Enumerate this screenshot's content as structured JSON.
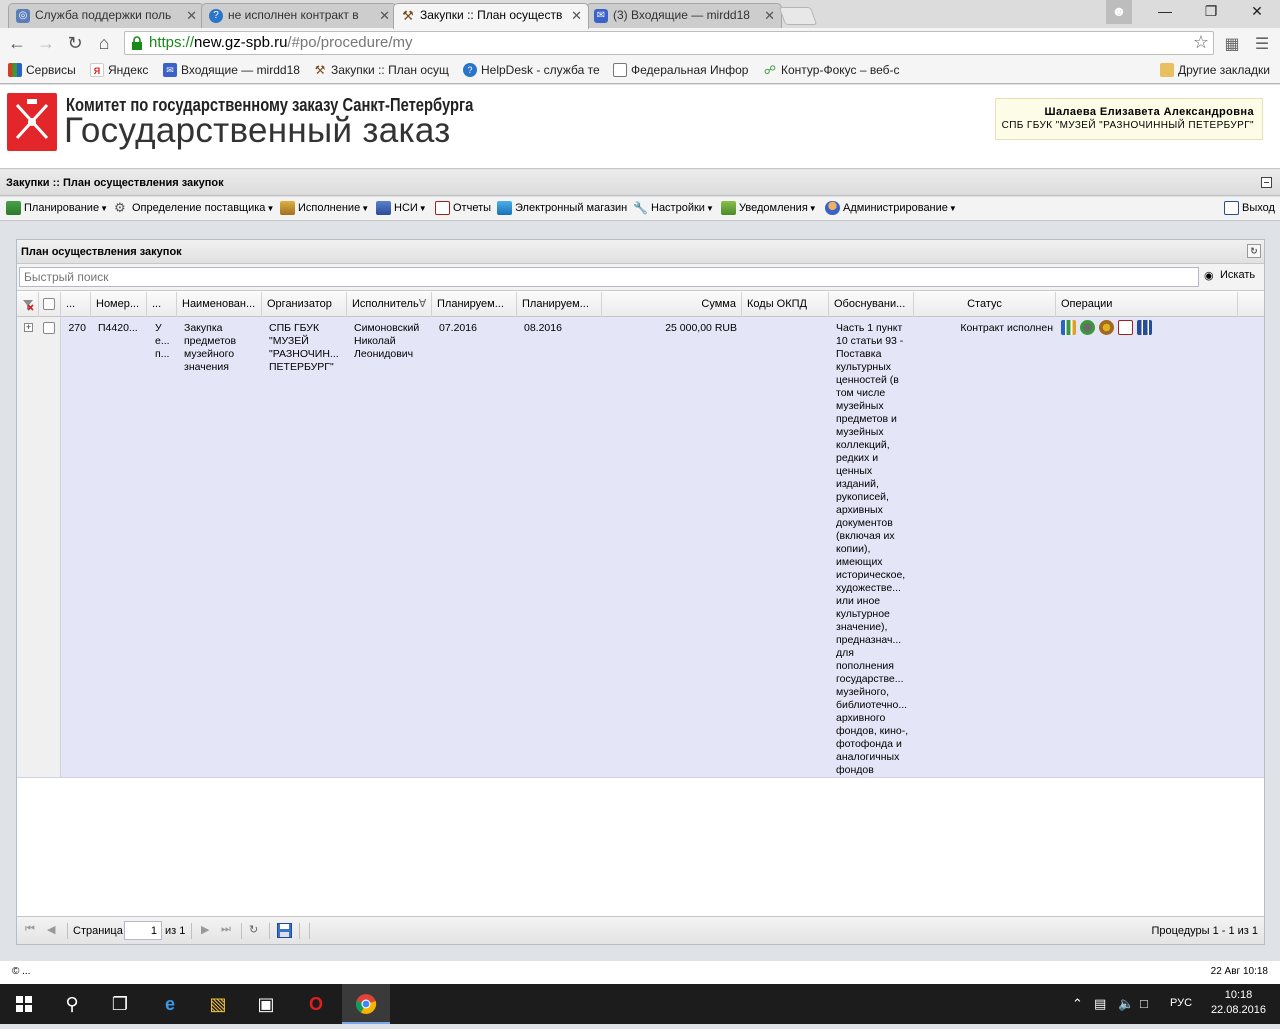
{
  "browser": {
    "tabs": [
      {
        "label": "Служба поддержки поль",
        "color": "#5a7fb8"
      },
      {
        "label": "не исполнен контракт в",
        "color": "#2a75c8"
      },
      {
        "label": "Закупки :: План осуществ",
        "color": "#8a5a2a"
      },
      {
        "label": "(3) Входящие — mirdd18",
        "color": "#3a62c8"
      }
    ],
    "url_scheme": "https://",
    "url_host": "new.gz-spb.ru",
    "url_path": "/#po/procedure/my",
    "bookmarks": [
      {
        "label": "Сервисы",
        "color": "#d04020"
      },
      {
        "label": "Яндекс",
        "color": "#e02020"
      },
      {
        "label": "Входящие — mirdd18",
        "color": "#3a62c8"
      },
      {
        "label": "Закупки :: План осущ",
        "color": "#8a5a2a"
      },
      {
        "label": "HelpDesk - служба те",
        "color": "#2a75c8"
      },
      {
        "label": "Федеральная Инфор",
        "color": "#888888"
      },
      {
        "label": "Контур-Фокус – веб-с",
        "color": "#3a9a3a"
      }
    ],
    "other_bookmarks": "Другие закладки"
  },
  "header": {
    "title": "Комитет по государственному заказу Санкт-Петербурга",
    "subtitle": "Государственный заказ",
    "user_name": "Шалаева Елизавета Александровна",
    "user_org": "СПБ ГБУК \"МУЗЕЙ \"РАЗНОЧИННЫЙ ПЕТЕРБУРГ\""
  },
  "titlebar": "Закупки :: План осуществления закупок",
  "menu": {
    "items": [
      {
        "label": "Планирование",
        "dropdown": true
      },
      {
        "label": "Определение поставщика",
        "dropdown": true
      },
      {
        "label": "Исполнение",
        "dropdown": true
      },
      {
        "label": "НСИ",
        "dropdown": true
      },
      {
        "label": "Отчеты",
        "dropdown": false
      },
      {
        "label": "Электронный магазин",
        "dropdown": false
      },
      {
        "label": "Настройки",
        "dropdown": true
      },
      {
        "label": "Уведомления",
        "dropdown": true
      },
      {
        "label": "Администрирование",
        "dropdown": true
      }
    ],
    "exit": "Выход"
  },
  "panel": {
    "title": "План осуществления закупок",
    "search_placeholder": "Быстрый поиск",
    "search_button": "Искать"
  },
  "grid": {
    "columns": [
      "...",
      "Номер...",
      "...",
      "Наименован...",
      "Организатор",
      "Исполнитель",
      "Планируем...",
      "Планируем...",
      "Сумма",
      "Коды ОКПД",
      "Обоснувани...",
      "Статус",
      "Операции"
    ],
    "row": {
      "id": "270",
      "number": "П4420...",
      "type": "У\nе...\nп...",
      "name": "Закупка\nпредметов\nмузейного\nзначения",
      "organizer": "СПБ ГБУК\n\"МУЗЕЙ\n\"РАЗНОЧИН...\nПЕТЕРБУРГ\"",
      "executor": "Симоновский\nНиколай\nЛеонидович",
      "planned1": "07.2016",
      "planned2": "08.2016",
      "sum": "25 000,00 RUB",
      "okpd": "",
      "justification": "Часть 1 пункт\n10 статьи 93 -\nПоставка\nкультурных\nценностей (в\nтом числе\nмузейных\nпредметов и\nмузейных\nколлекций,\nредких и\nценных\nизданий,\nрукописей,\nархивных\nдокументов\n(включая их\nкопии),\nимеющих\nисторическое,\nхудожестве...\nили иное\nкультурное\nзначение),\nпредназнач...\nдля\nпополнения\nгосударстве...\nмузейного,\nбиблиотечно...\nархивного\nфондов, кино-,\nфотофонда и\nаналогичных\nфондов",
      "status": "Контракт исполнен"
    }
  },
  "pager": {
    "page_label": "Страница",
    "page_value": "1",
    "page_of": "из 1",
    "info": "Процедуры 1 - 1 из 1"
  },
  "footer": {
    "copyright": "© ...",
    "datetime": "22 Авг 10:18"
  },
  "taskbar": {
    "lang": "РУС",
    "time": "10:18",
    "date": "22.08.2016"
  }
}
